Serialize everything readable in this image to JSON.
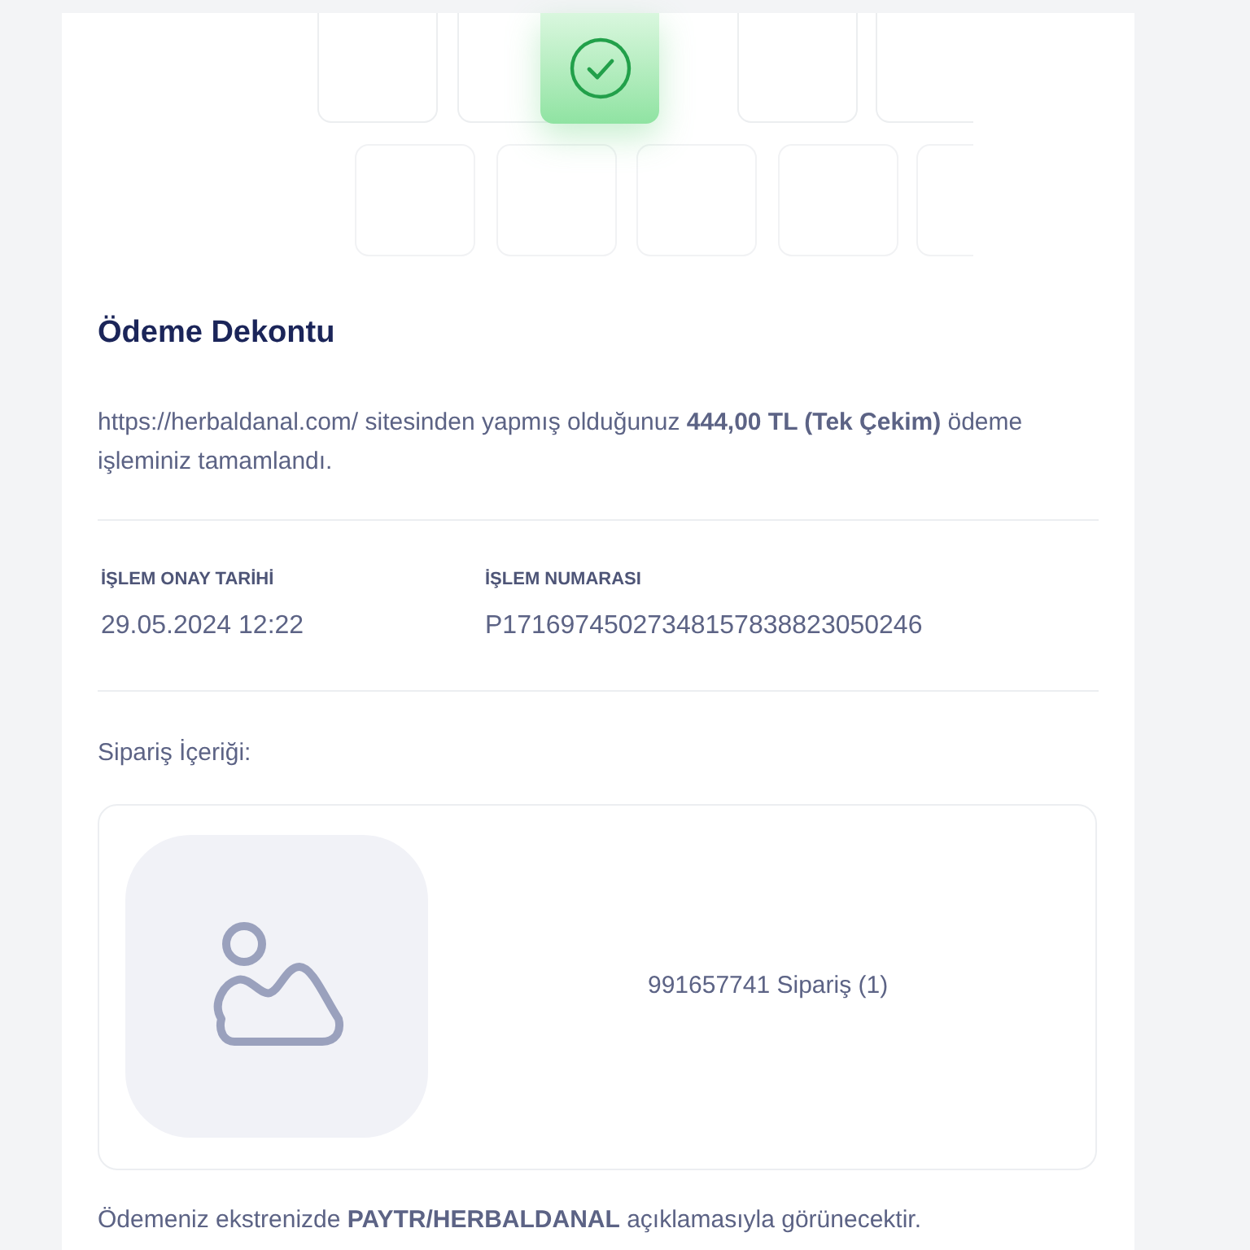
{
  "title": "Ödeme Dekontu",
  "message": "https://herbaldanal.com/ sitesinden yapmış olduğunuz **444,00 TL (Tek Çekim)** ödeme işleminiz tamamlandı.",
  "details": [
    {
      "label": "İŞLEM ONAY TARİHİ",
      "value": "29.05.2024 12:22"
    },
    {
      "label": "İŞLEM NUMARASI",
      "value": "P17169745027348157838823050246"
    }
  ],
  "order_heading": "Sipariş İçeriği:",
  "order_items": [
    {
      "name": "991657741 Sipariş (1)"
    }
  ],
  "footer": "Ödemeniz ekstrenizde **PAYTR/HERBALDANAL** açıklamasıyla görünecektir."
}
